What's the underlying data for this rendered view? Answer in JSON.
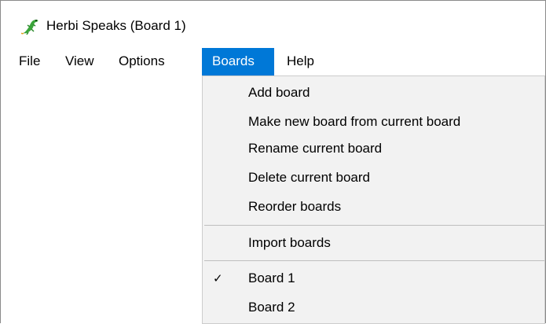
{
  "window": {
    "title": "Herbi Speaks (Board 1)",
    "icon": "herbi-lizard-icon"
  },
  "menubar": {
    "items": [
      {
        "label": "File"
      },
      {
        "label": "View"
      },
      {
        "label": "Options"
      },
      {
        "label": "Boards",
        "active": true
      },
      {
        "label": "Help"
      }
    ]
  },
  "boards_menu": {
    "items": [
      {
        "label": "Add board"
      },
      {
        "label": "Make new board from current board"
      },
      {
        "label": "Rename current board"
      },
      {
        "label": "Delete current board"
      },
      {
        "label": "Reorder boards"
      },
      {
        "label": "Import boards"
      },
      {
        "label": "Board 1",
        "checked": true,
        "check_glyph": "✓"
      },
      {
        "label": "Board 2",
        "checked": false
      }
    ]
  },
  "colors": {
    "menu_highlight": "#0078d7",
    "dropdown_bg": "#f2f2f2",
    "separator": "#bfbfbf"
  }
}
